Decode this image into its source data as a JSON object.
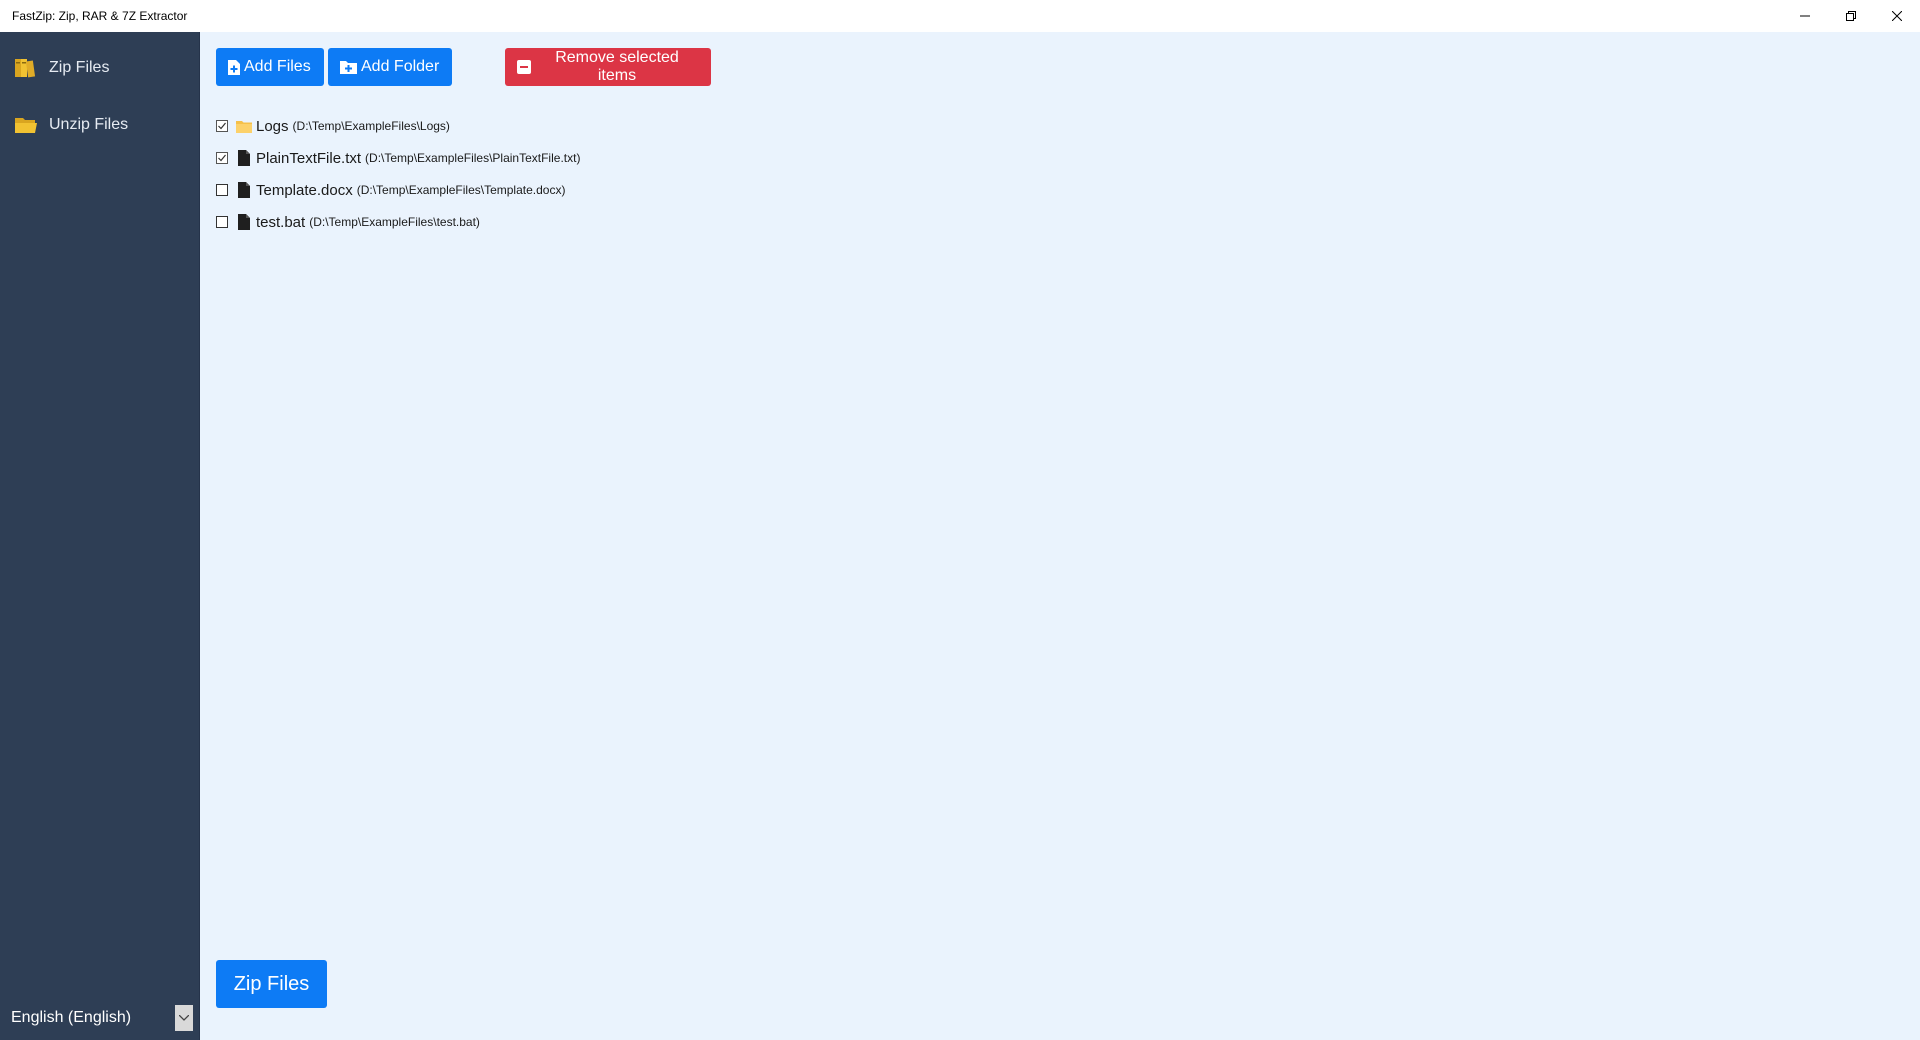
{
  "window": {
    "title": "FastZip: Zip, RAR & 7Z Extractor"
  },
  "sidebar": {
    "items": [
      {
        "label": "Zip Files",
        "icon": "archive-books-icon"
      },
      {
        "label": "Unzip Files",
        "icon": "open-folder-icon"
      }
    ],
    "language": {
      "selected": "English (English)"
    }
  },
  "toolbar": {
    "add_files_label": "Add Files",
    "add_folder_label": "Add Folder",
    "remove_label": "Remove selected items"
  },
  "files": [
    {
      "name": "Logs",
      "path": "(D:\\Temp\\ExampleFiles\\Logs)",
      "type": "folder",
      "checked": true
    },
    {
      "name": "PlainTextFile.txt",
      "path": "(D:\\Temp\\ExampleFiles\\PlainTextFile.txt)",
      "type": "file",
      "checked": true
    },
    {
      "name": "Template.docx",
      "path": "(D:\\Temp\\ExampleFiles\\Template.docx)",
      "type": "file",
      "checked": false
    },
    {
      "name": "test.bat",
      "path": "(D:\\Temp\\ExampleFiles\\test.bat)",
      "type": "file",
      "checked": false
    }
  ],
  "actions": {
    "zip_label": "Zip Files"
  },
  "colors": {
    "sidebar_bg": "#2e3e55",
    "main_bg": "#eaf3fd",
    "primary": "#0d7bf5",
    "danger": "#dc3545",
    "folder": "#f5c04a"
  }
}
